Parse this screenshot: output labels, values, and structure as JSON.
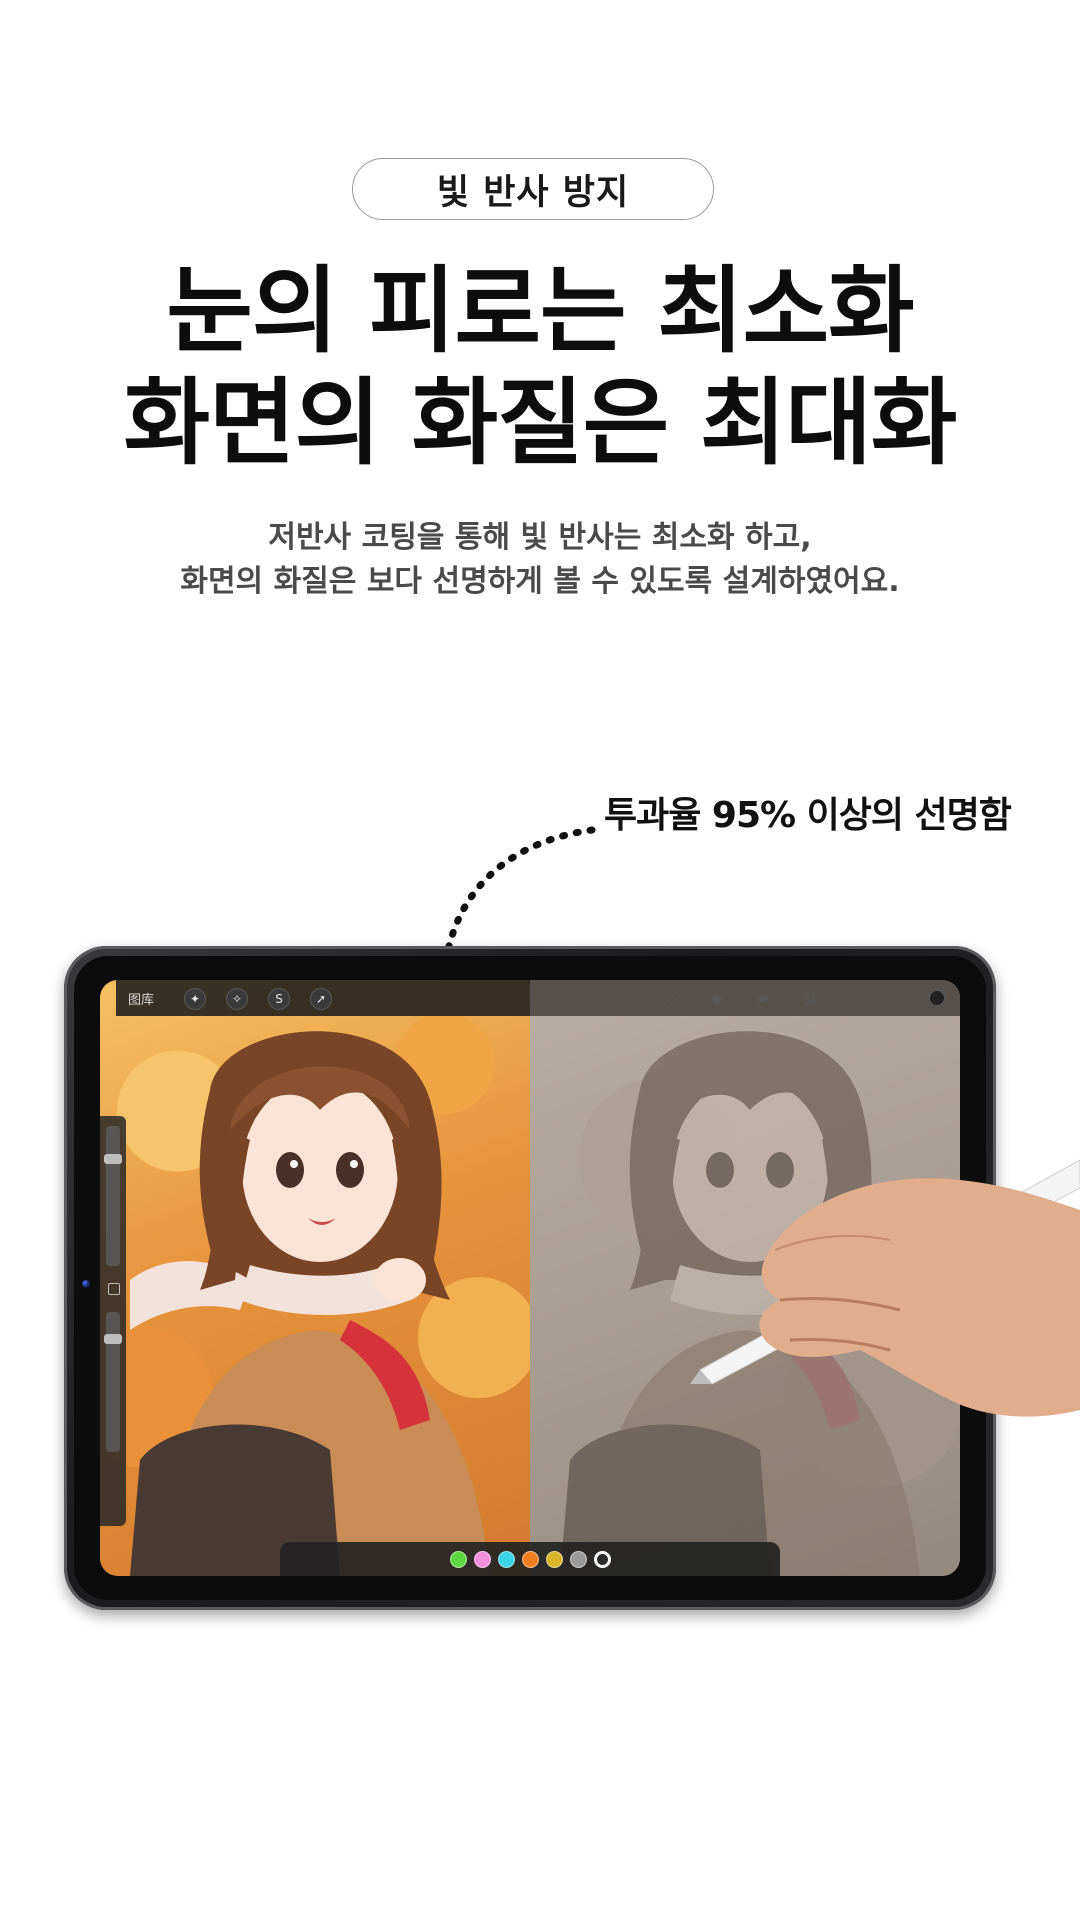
{
  "badge": {
    "label": "빛 반사 방지"
  },
  "headline": {
    "line1": "눈의 피로는 최소화",
    "line2": "화면의 화질은 최대화"
  },
  "description": {
    "line1": "저반사 코팅을 통해 빛 반사는 최소화 하고,",
    "line2": "화면의 화질은 보다 선명하게 볼 수 있도록 설계하였어요."
  },
  "callout": {
    "text": "투과율 95% 이상의 선명함"
  },
  "tablet_screen": {
    "toolbar_label": "图库",
    "left_icons": [
      "wrench-icon",
      "magic-wand-icon",
      "s-curve-icon",
      "arrow-icon"
    ],
    "right_tools": [
      "brush-icon",
      "smudge-icon",
      "eraser-icon",
      "layers-icon"
    ],
    "palette": [
      {
        "color": "#5ed641"
      },
      {
        "color": "#f08fdc"
      },
      {
        "color": "#3bd3e6"
      },
      {
        "color": "#f07f21"
      },
      {
        "color": "#d9b42a"
      },
      {
        "color": "#9a9a9a"
      },
      {
        "color": "#2a2a2a",
        "active": true
      }
    ]
  },
  "colors": {
    "text_primary": "#0d0d0d",
    "text_secondary": "#4a4a4a",
    "pill_border": "#9a9a9a",
    "device_frame": "#1b1b1d"
  }
}
